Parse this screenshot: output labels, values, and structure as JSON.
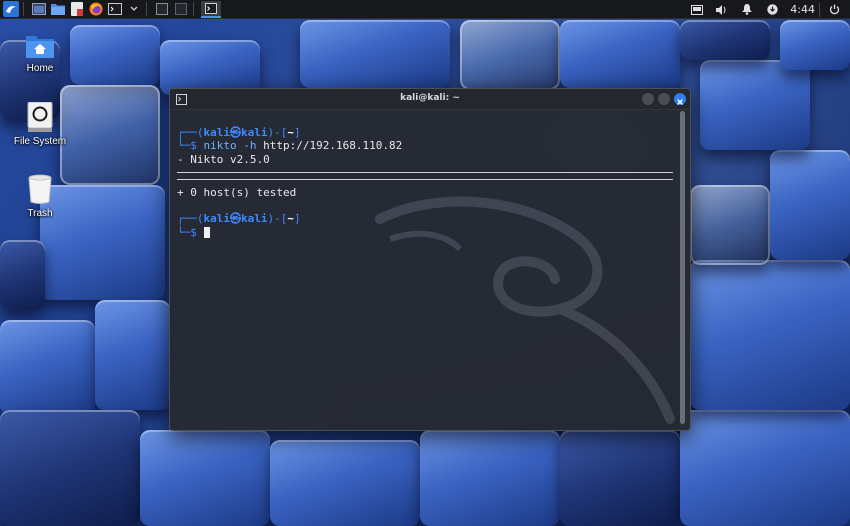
{
  "panel": {
    "clock": "4:44",
    "icons": [
      "kali-menu-icon",
      "workspace-icon",
      "file-manager-icon",
      "text-editor-icon",
      "firefox-icon",
      "terminal-icon"
    ]
  },
  "desktop": {
    "icons": [
      {
        "label": "Home",
        "icon": "home-folder-icon"
      },
      {
        "label": "File System",
        "icon": "drive-icon"
      },
      {
        "label": "Trash",
        "icon": "trash-icon"
      }
    ]
  },
  "terminal": {
    "title": "kali@kali: ~",
    "prompt1_open": "┌──(",
    "user": "kali",
    "at": "㉿",
    "host": "kali",
    "prompt1_close": ")-[",
    "dir": "~",
    "prompt1_end": "]",
    "prompt2": "└─",
    "dollar": "$ ",
    "command_name": "nikto",
    "command_flag": " -h",
    "command_arg": " http://192.168.110.82",
    "output_version": "- Nikto v2.5.0",
    "output_hosts": "+ 0 host(s) tested"
  }
}
